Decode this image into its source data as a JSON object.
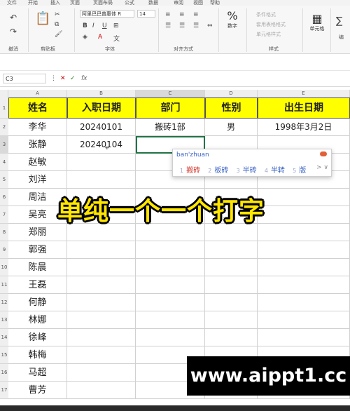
{
  "ribbon": {
    "tabs": [
      "开始",
      "插入",
      "页面",
      "页面布局",
      "公式",
      "数据",
      "审阅",
      "视图",
      "帮助"
    ],
    "font_name": "阿里巴巴普惠体 R",
    "font_size": "14",
    "groups": {
      "clipboard_left": "撤消",
      "clipboard": "剪贴板",
      "font": "字体",
      "alignment": "对齐方式",
      "number": "数字",
      "styles": "样式",
      "cells": "单元格",
      "editing": "编"
    },
    "styles_items": [
      "条件格式",
      "套用表格格式",
      "单元格样式"
    ],
    "number_label": "数字",
    "cells_label": "单元格"
  },
  "formula_bar": {
    "name_box": "C3",
    "fx": "fx",
    "value": ""
  },
  "columns": [
    "A",
    "B",
    "C",
    "D",
    "E"
  ],
  "rows": [
    "1",
    "2",
    "3",
    "4",
    "5",
    "6",
    "7",
    "8",
    "9",
    "10",
    "11",
    "12",
    "13",
    "14",
    "15",
    "16",
    "17"
  ],
  "headers": [
    "姓名",
    "入职日期",
    "部门",
    "性别",
    "出生日期"
  ],
  "names": [
    "李华",
    "张静",
    "赵敏",
    "刘洋",
    "周洁",
    "吴亮",
    "郑丽",
    "郭强",
    "陈晨",
    "王磊",
    "何静",
    "林娜",
    "徐峰",
    "韩梅",
    "马超",
    "曹芳"
  ],
  "row2": {
    "date": "20240101",
    "dept": "搬砖1部",
    "gender": "男",
    "birth": "1998年3月2日"
  },
  "row3": {
    "date": "20240104"
  },
  "ime": {
    "pinyin": "ban'zhuan",
    "candidates": [
      {
        "n": "1",
        "w": "搬砖"
      },
      {
        "n": "2",
        "w": "板砖"
      },
      {
        "n": "3",
        "w": "半砖"
      },
      {
        "n": "4",
        "w": "半转"
      },
      {
        "n": "5",
        "w": "版"
      }
    ],
    "more": "> ∨"
  },
  "overlay_caption": "单纯一个一个打字",
  "watermark": "www.aippt1.cc",
  "colors": {
    "header_fill": "#ffff00",
    "overlay_text": "#ffe600",
    "ime_accent": "#3a62c4",
    "ime_first": "#d4382c"
  }
}
